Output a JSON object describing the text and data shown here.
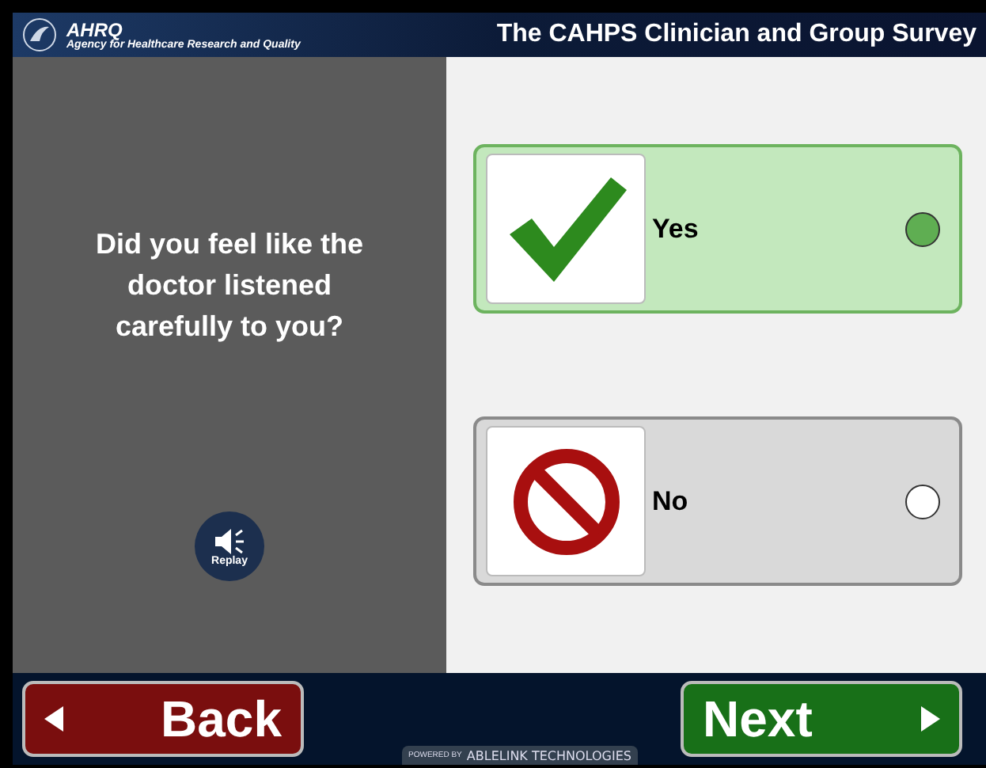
{
  "header": {
    "logo": "AHRQ",
    "agency": "Agency for Healthcare Research and Quality",
    "title": "The CAHPS Clinician and Group Survey"
  },
  "question": {
    "text": "Did you feel like the doctor listened carefully to you?",
    "replay": "Replay"
  },
  "options": [
    {
      "kind": "check",
      "label": "Yes",
      "selected": true
    },
    {
      "kind": "prohibit",
      "label": "No",
      "selected": false
    }
  ],
  "footer": {
    "back": "Back",
    "next": "Next",
    "powered_by": "POWERED BY",
    "brand": "ABLELINK TECHNOLOGIES"
  }
}
